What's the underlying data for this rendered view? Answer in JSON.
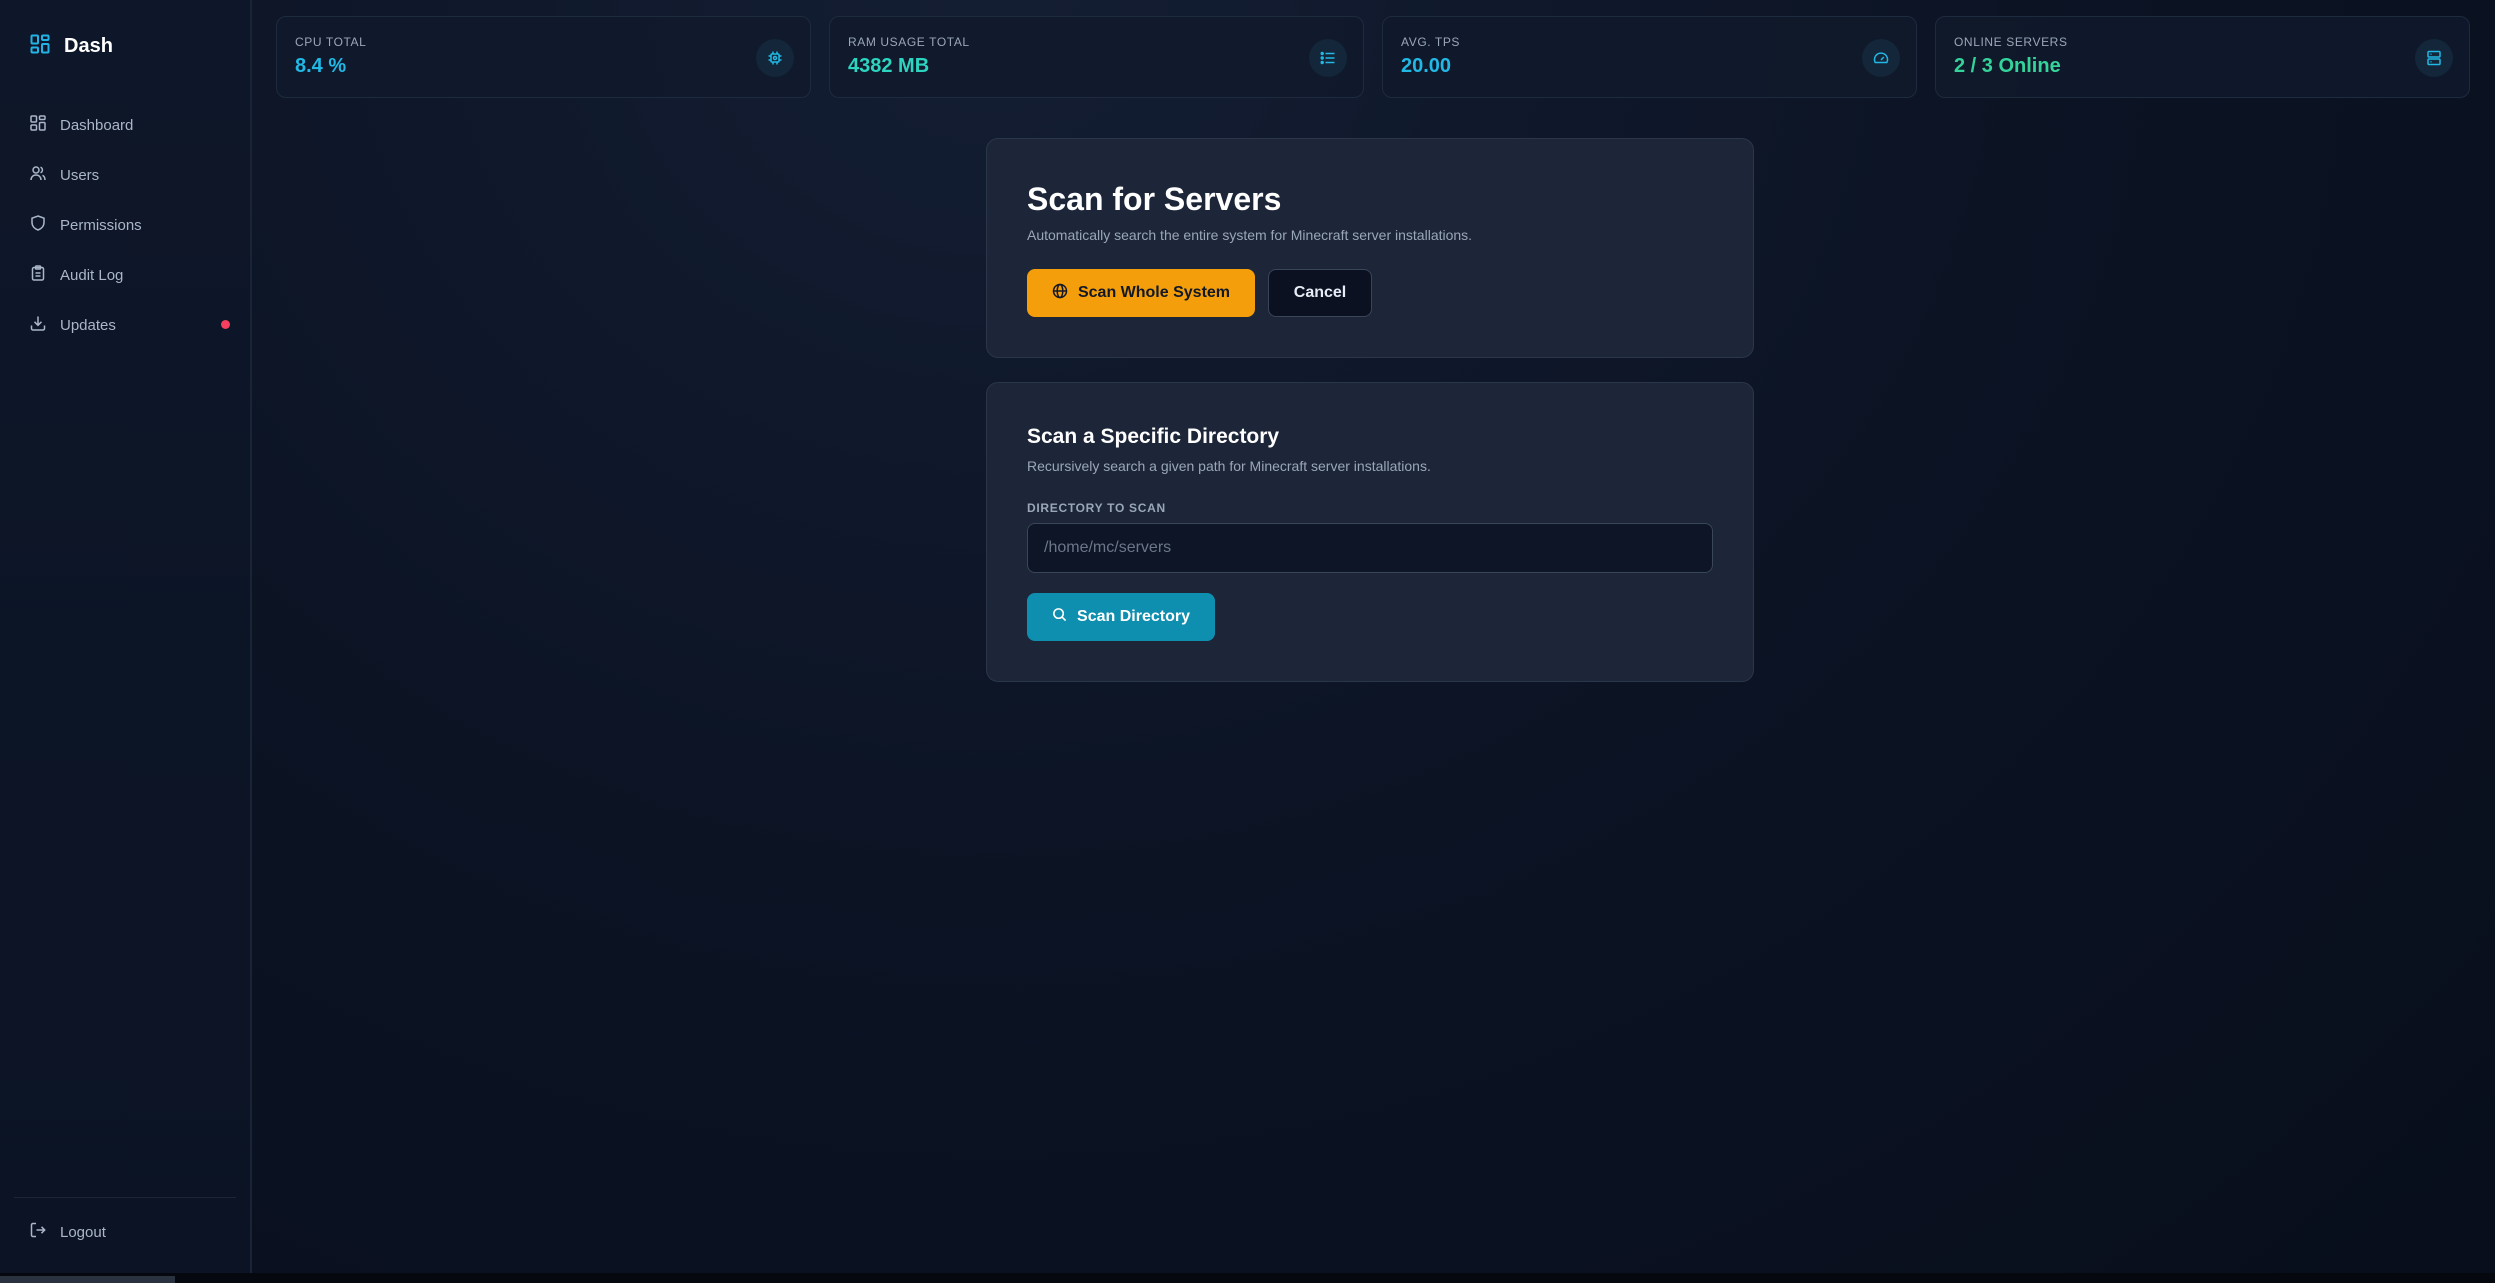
{
  "brand": {
    "name": "Dash",
    "icon": "grid-icon",
    "accent": "#22b3e6"
  },
  "sidebar": {
    "items": [
      {
        "label": "Dashboard",
        "icon": "dashboard-grid-icon"
      },
      {
        "label": "Users",
        "icon": "users-icon"
      },
      {
        "label": "Permissions",
        "icon": "shield-icon"
      },
      {
        "label": "Audit Log",
        "icon": "clipboard-icon"
      },
      {
        "label": "Updates",
        "icon": "download-icon",
        "badge": "notification-dot",
        "badge_color": "#f43f5e"
      }
    ],
    "logout": {
      "label": "Logout",
      "icon": "logout-icon"
    }
  },
  "stats": [
    {
      "label": "CPU TOTAL",
      "value": "8.4 %",
      "icon": "cpu-chip-icon",
      "color": "#22b8e6"
    },
    {
      "label": "RAM USAGE TOTAL",
      "value": "4382 MB",
      "icon": "memory-list-icon",
      "color": "#2dd4bf"
    },
    {
      "label": "AVG. TPS",
      "value": "20.00",
      "icon": "gauge-icon",
      "color": "#22b8e6"
    },
    {
      "label": "ONLINE SERVERS",
      "value": "2 / 3 Online",
      "icon": "server-icon",
      "color": "#34d399"
    }
  ],
  "scan_panel": {
    "title": "Scan for Servers",
    "description": "Automatically search the entire system for Minecraft server installations.",
    "scan_button": {
      "label": "Scan Whole System",
      "icon": "globe-icon",
      "color": "#f59e0b"
    },
    "cancel_button": {
      "label": "Cancel"
    }
  },
  "directory_panel": {
    "title": "Scan a Specific Directory",
    "description": "Recursively search a given path for Minecraft server installations.",
    "field_label": "DIRECTORY TO SCAN",
    "input_value": "",
    "input_placeholder": "/home/mc/servers",
    "scan_button": {
      "label": "Scan Directory",
      "icon": "search-icon",
      "color": "#0e8fb0"
    }
  }
}
